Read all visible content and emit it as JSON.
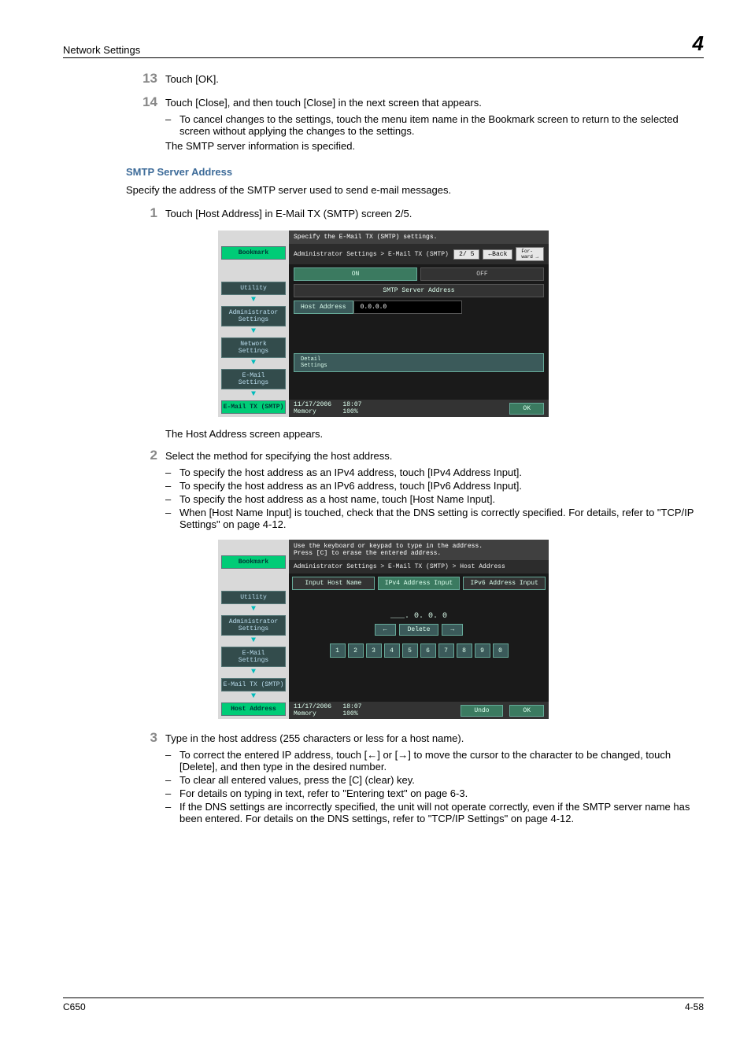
{
  "header": {
    "title": "Network Settings",
    "chapter": "4"
  },
  "step13": {
    "num": "13",
    "text": "Touch [OK]."
  },
  "step14": {
    "num": "14",
    "text": "Touch [Close], and then touch [Close] in the next screen that appears.",
    "sub1": "To cancel changes to the settings, touch the menu item name in the Bookmark screen to return to the selected screen without applying the changes to the settings.",
    "after": "The SMTP server information is specified."
  },
  "sectionHeading": "SMTP Server Address",
  "sectionIntro": "Specify the address of the SMTP server used to send e-mail messages.",
  "step1": {
    "num": "1",
    "text": "Touch [Host Address] in E-Mail TX (SMTP) screen 2/5."
  },
  "shot1": {
    "top": "Specify the E-Mail TX (SMTP) settings.",
    "crumb": "Administrator Settings > E-Mail TX (SMTP)",
    "page": "2/ 5",
    "back": "←Back",
    "fwd": "For-\nward →",
    "on": "ON",
    "off": "OFF",
    "labelBar": "SMTP Server Address",
    "hostBtn": "Host Address",
    "hostVal": "0.0.0.0",
    "detail": "Detail\nSettings",
    "footL": "11/17/2006   18:07\nMemory       100%",
    "ok": "OK",
    "side": {
      "bookmark": "Bookmark",
      "utility": "Utility",
      "admin": "Administrator\nSettings",
      "net": "Network\nSettings",
      "email": "E-Mail\nSettings",
      "emailtx": "E-Mail TX (SMTP)"
    }
  },
  "afterShot1": "The Host Address screen appears.",
  "step2": {
    "num": "2",
    "text": "Select the method for specifying the host address.",
    "b1": "To specify the host address as an IPv4 address, touch [IPv4 Address Input].",
    "b2": "To specify the host address as an IPv6 address, touch [IPv6 Address Input].",
    "b3": "To specify the host address as a host name, touch [Host Name Input].",
    "b4": "When [Host Name Input] is touched, check that the DNS setting is correctly specified. For details, refer to \"TCP/IP Settings\" on page 4-12."
  },
  "shot2": {
    "top": "Use the keyboard or keypad to type in the address.\nPress [C] to erase the entered address.",
    "crumb": "Administrator Settings > E-Mail TX (SMTP) > Host Address",
    "tab1": "Input Host Name",
    "tab2": "IPv4 Address Input",
    "tab3": "IPv6 Address Input",
    "ipDisp": "___.   0.   0.   0",
    "left": "←",
    "del": "Delete",
    "right": "→",
    "keys": [
      "1",
      "2",
      "3",
      "4",
      "5",
      "6",
      "7",
      "8",
      "9",
      "0"
    ],
    "footL": "11/17/2006   18:07\nMemory       100%",
    "undo": "Undo",
    "ok": "OK",
    "side": {
      "bookmark": "Bookmark",
      "utility": "Utility",
      "admin": "Administrator\nSettings",
      "email": "E-Mail\nSettings",
      "emailtx": "E-Mail TX (SMTP)",
      "hostaddr": "Host Address"
    }
  },
  "step3": {
    "num": "3",
    "text": "Type in the host address (255 characters or less for a host name).",
    "b1": "To correct the entered IP address, touch [←] or [→] to move the cursor to the character to be changed, touch [Delete], and then type in the desired number.",
    "b2": "To clear all entered values, press the [C] (clear) key.",
    "b3": "For details on typing in text, refer to \"Entering text\" on page 6-3.",
    "b4": "If the DNS settings are incorrectly specified, the unit will not operate correctly, even if the SMTP server name has been entered. For details on the DNS settings, refer to \"TCP/IP Settings\" on page 4-12."
  },
  "footer": {
    "left": "C650",
    "right": "4-58"
  }
}
